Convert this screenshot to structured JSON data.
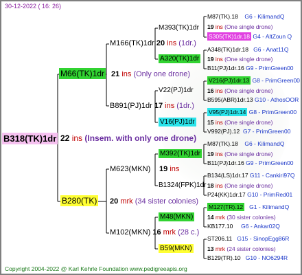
{
  "header": {
    "date": "30-12-2022 ( 16: 26)"
  },
  "footer": {
    "copyright": "Copyright 2004-2022 @ Karl Kehrle Foundation    www.pedigreeapis.org"
  },
  "root": {
    "name": "B318(TK)1dr",
    "num": "22",
    "mrk": "ins",
    "note": "(Insem. with only one drone)"
  },
  "gen1": [
    {
      "name": "M66(TK)1dr",
      "num": "21",
      "mrk": "ins",
      "note": "(Only one drone)",
      "highlight": "#31d331"
    },
    {
      "name": "B280(TK)",
      "num": "20",
      "mrk": "mrk",
      "note": "(34 sister colonies)",
      "highlight": "#ffff33"
    }
  ],
  "gen2": [
    {
      "name": "M166(TK)1dr",
      "num": "20",
      "mrk": "ins",
      "note": "(1dr.)"
    },
    {
      "name": "B891(PJ)1dr",
      "num": "17",
      "mrk": "ins",
      "note": "(1dr.)"
    },
    {
      "name": "M623(MKN)",
      "num": "19",
      "mrk": "ins",
      "note": ""
    },
    {
      "name": "M102(MKN)",
      "num": "16",
      "mrk": "mrk",
      "note": "(28 c.)"
    }
  ],
  "gen3": [
    {
      "name": "M393(TK)1dr",
      "highlight": ""
    },
    {
      "name": "A320(TK)1dr",
      "highlight": "#31d331"
    },
    {
      "name": "V22(PJ)1dr",
      "highlight": ""
    },
    {
      "name": "V16(PJ)1dr",
      "highlight": "#29e4ea"
    },
    {
      "name": "M392(TK)1dr",
      "highlight": "#31d331"
    },
    {
      "name": "B1324(FPK)1dr",
      "highlight": ""
    },
    {
      "name": "M48(MKN)",
      "highlight": "#31d331"
    },
    {
      "name": "B59(MKN)",
      "highlight": "#ffff33"
    }
  ],
  "gen4": [
    {
      "name": "M87(TK).18",
      "code": "G6 - KilimandQ",
      "num": "19",
      "mrk": "ins",
      "note": "(One single drone)",
      "sub": "S305(TK)1dr.18",
      "subcode": "G4 - AltZoun Q",
      "subhl": "magenta"
    },
    {
      "name": "A348(TK)1dr.18",
      "code": "G6 - Anat11Q",
      "num": "19",
      "mrk": "ins",
      "note": "(One single drone)",
      "sub": "B11(PJ)1dr.16",
      "subcode": "G9 - PrimGreen00",
      "subhl": ""
    },
    {
      "name": "V216(PJ)1dr.13",
      "code": "G8 - PrimGreen00",
      "num": "16",
      "mrk": "ins",
      "note": "(One single drone)",
      "sub": "B595(ABR)1dr.13",
      "subcode": "G10 - AthosOOR",
      "subhl": "",
      "namehl": "green"
    },
    {
      "name": "V95(PJ)1dr.14",
      "code": "G8 - PrimGreen00",
      "num": "15",
      "mrk": "ins",
      "note": "(One single drone)",
      "sub": "V992(PJ).12",
      "subcode": "G7 - PrimGreen00",
      "subhl": "",
      "namehl": "cyan"
    },
    {
      "name": "M87(TK).18",
      "code": "G6 - KilimandQ",
      "num": "19",
      "mrk": "ins",
      "note": "(One single drone)",
      "sub": "B11(PJ)1dr.16",
      "subcode": "G9 - PrimGreen00",
      "subhl": ""
    },
    {
      "name": "B134(LS)1dr.17",
      "code": "G11 - Cankiri97Q",
      "num": "18",
      "mrk": "ins",
      "note": "(One single drone)",
      "sub": "P24(KK)1dr.17",
      "subcode": "G10 - PrimRed01",
      "subhl": ""
    },
    {
      "name": "M127(TR).12",
      "code": "G1 - KilimandQ",
      "num": "14",
      "mrk": "mrk",
      "note": "(30 sister colonies)",
      "sub": "KB177.10",
      "subcode": "G6 - Ankar02Q",
      "subhl": "",
      "namehl": "green"
    },
    {
      "name": "ST206.11",
      "code": "G15 - SinopEgg86R",
      "num": "13",
      "mrk": "mrk",
      "note": "(24 sister colonies)",
      "sub": "B129(TR).10",
      "subcode": "G10 - NO6294R",
      "subhl": ""
    }
  ]
}
